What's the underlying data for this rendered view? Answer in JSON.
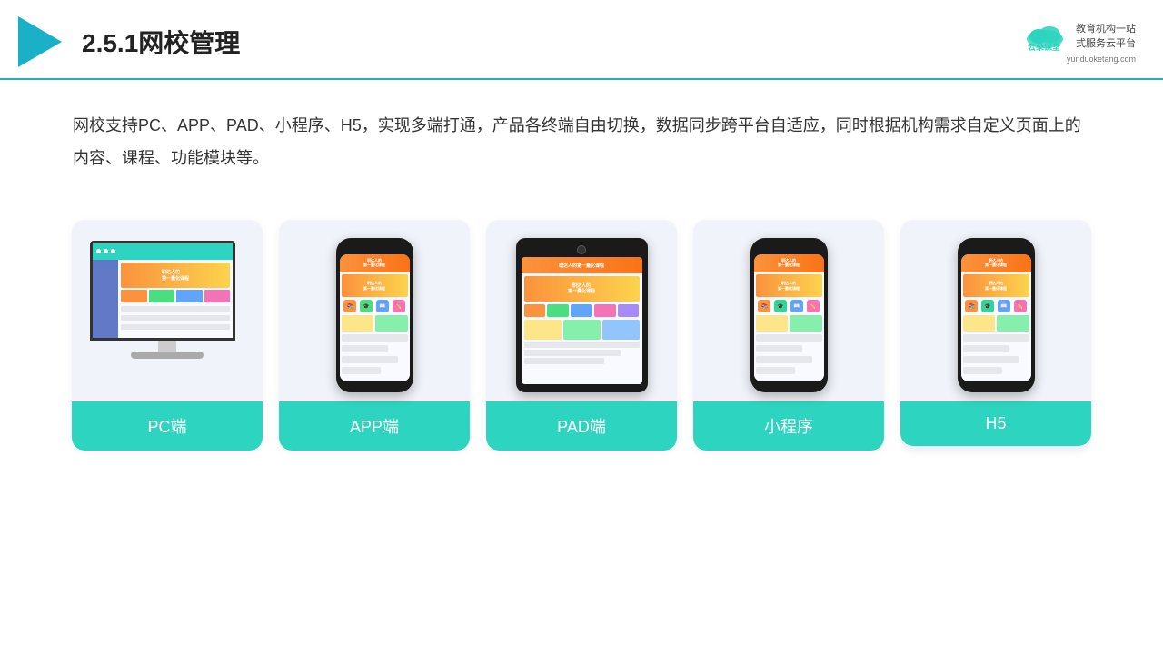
{
  "header": {
    "title": "2.5.1网校管理",
    "brand": {
      "name": "云朵课堂",
      "tagline1": "教育机构一站",
      "tagline2": "式服务云平台",
      "url": "yunduoketang.com"
    }
  },
  "description": "网校支持PC、APP、PAD、小程序、H5，实现多端打通，产品各终端自由切换，数据同步跨平台自适应，同时根据机构需求自定义页面上的内容、课程、功能模块等。",
  "cards": [
    {
      "id": "pc",
      "label": "PC端"
    },
    {
      "id": "app",
      "label": "APP端"
    },
    {
      "id": "pad",
      "label": "PAD端"
    },
    {
      "id": "miniapp",
      "label": "小程序"
    },
    {
      "id": "h5",
      "label": "H5"
    }
  ],
  "colors": {
    "teal": "#2dd4bf",
    "accent": "#1ab0c8",
    "orange": "#f97316",
    "yellow": "#fcd34d"
  }
}
